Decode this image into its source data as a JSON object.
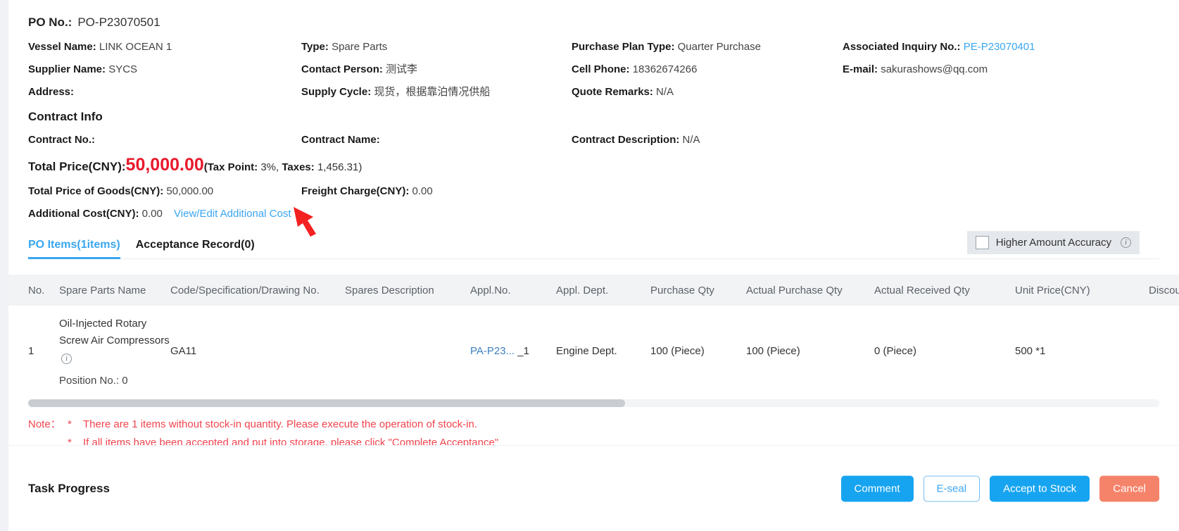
{
  "header": {
    "po_no_label": "PO No.:",
    "po_no_value": "PO-P23070501"
  },
  "info": {
    "vessel_name_label": "Vessel Name:",
    "vessel_name_value": "LINK OCEAN 1",
    "type_label": "Type:",
    "type_value": "Spare Parts",
    "purchase_plan_type_label": "Purchase Plan Type:",
    "purchase_plan_type_value": "Quarter Purchase",
    "associated_inquiry_label": "Associated Inquiry No.:",
    "associated_inquiry_value": "PE-P23070401",
    "supplier_name_label": "Supplier Name:",
    "supplier_name_value": "SYCS",
    "contact_person_label": "Contact Person:",
    "contact_person_value": "测试李",
    "cell_phone_label": "Cell Phone:",
    "cell_phone_value": "18362674266",
    "email_label": "E-mail:",
    "email_value": "sakurashows@qq.com",
    "address_label": "Address:",
    "address_value": "",
    "supply_cycle_label": "Supply Cycle:",
    "supply_cycle_value": "现货，根据靠泊情况供船",
    "quote_remarks_label": "Quote Remarks:",
    "quote_remarks_value": "N/A"
  },
  "contract": {
    "section_title": "Contract Info",
    "contract_no_label": "Contract No.:",
    "contract_no_value": "",
    "contract_name_label": "Contract Name:",
    "contract_name_value": "",
    "contract_description_label": "Contract Description:",
    "contract_description_value": "N/A"
  },
  "totals": {
    "total_price_label": "Total Price(CNY):",
    "total_price_value": "50,000.00",
    "tax_point_label": "(Tax Point:",
    "tax_point_value": "3%,",
    "taxes_label": "Taxes:",
    "taxes_value": "1,456.31)",
    "total_price_goods_label": "Total Price of Goods(CNY):",
    "total_price_goods_value": "50,000.00",
    "freight_charge_label": "Freight Charge(CNY):",
    "freight_charge_value": "0.00",
    "additional_cost_label": "Additional Cost(CNY):",
    "additional_cost_value": "0.00",
    "view_edit_additional_cost": "View/Edit Additional Cost",
    "amount_color": "#e8192c"
  },
  "tabs": [
    {
      "label": "PO Items(1items)",
      "active": true
    },
    {
      "label": "Acceptance Record(0)",
      "active": false
    }
  ],
  "accuracy": {
    "label": "Higher Amount Accuracy",
    "checked": false,
    "info_glyph": "i"
  },
  "table": {
    "columns": [
      "No.",
      "Spare Parts Name",
      "Code/Specification/Drawing No.",
      "Spares Description",
      "Appl.No.",
      "Appl. Dept.",
      "Purchase Qty",
      "Actual Purchase Qty",
      "Actual Received Qty",
      "Unit Price(CNY)",
      "Discount"
    ],
    "rows": [
      {
        "no": "1",
        "parts_name": "Oil-Injected Rotary Screw Air Compressors",
        "parts_info_glyph": "i",
        "position_no_label": "Position No.:",
        "position_no_value": "0",
        "code_spec": "GA11",
        "spares_description": "",
        "appl_no_link": "PA-P23...",
        "appl_no_suffix": "_1",
        "appl_dept": "Engine Dept.",
        "purchase_qty": "100 (Piece)",
        "actual_purchase_qty": "100 (Piece)",
        "actual_received_qty": "0 (Piece)",
        "unit_price": "500 *1",
        "discount": ""
      }
    ]
  },
  "notes": {
    "label": "Note：",
    "star": "*",
    "line1": "There are 1 items without stock-in quantity. Please execute the operation of stock-in.",
    "line2": "If all items have been accepted and put into storage, please click \"Complete Acceptance\""
  },
  "footer": {
    "task_progress_label": "Task Progress",
    "buttons": [
      {
        "label": "Comment",
        "style": "primary"
      },
      {
        "label": "E-seal",
        "style": "ghost"
      },
      {
        "label": "Accept to Stock",
        "style": "primary"
      },
      {
        "label": "Cancel",
        "style": "danger"
      }
    ]
  },
  "annotation": {
    "arrow_color": "#f42121"
  }
}
